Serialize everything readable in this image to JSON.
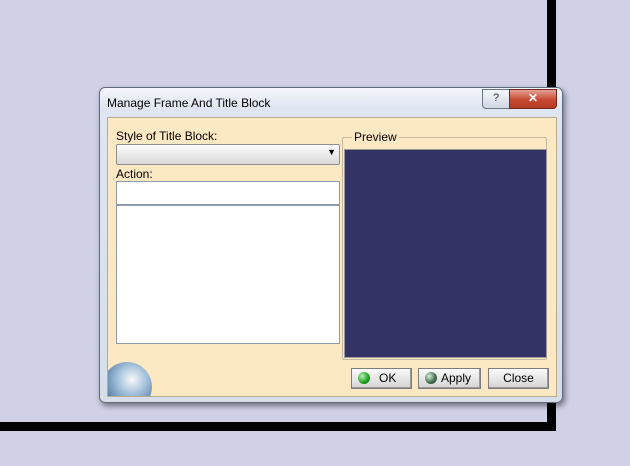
{
  "dialog": {
    "title": "Manage Frame And Title Block",
    "help_label": "?",
    "close_label": "✕"
  },
  "form": {
    "style_label": "Style of Title Block:",
    "style_value": "",
    "action_label": "Action:",
    "action_value": "",
    "actions": []
  },
  "preview": {
    "label": "Preview",
    "background": "#343366"
  },
  "buttons": {
    "ok": "OK",
    "apply": "Apply",
    "close": "Close"
  }
}
